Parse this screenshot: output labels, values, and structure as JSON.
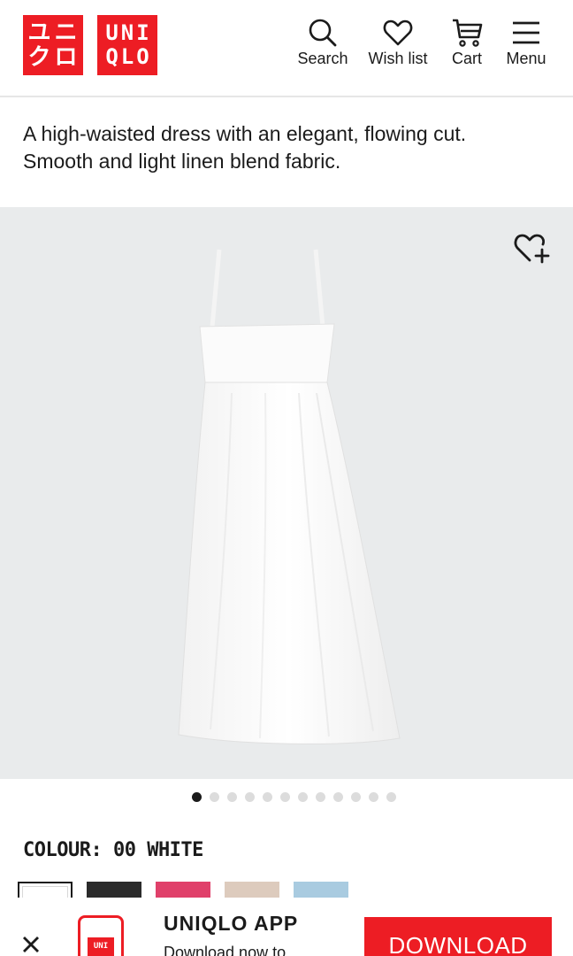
{
  "header": {
    "logo_kana_top": "ユニ",
    "logo_kana_bottom": "クロ",
    "logo_latin_top": "UNI",
    "logo_latin_bottom": "QLO",
    "nav": {
      "search_label": "Search",
      "wishlist_label": "Wish list",
      "cart_label": "Cart",
      "menu_label": "Menu"
    }
  },
  "product": {
    "description_line1": "A high-waisted dress with an elegant, flowing cut.",
    "description_line2": "Smooth and light linen blend fabric.",
    "image_count": 12,
    "active_image": 1,
    "colour_label": "COLOUR: 00 WHITE",
    "swatches": [
      {
        "name": "white",
        "color": "#ffffff"
      },
      {
        "name": "black",
        "color": "#2b2b2b"
      },
      {
        "name": "pink",
        "color": "#e0406a"
      },
      {
        "name": "beige",
        "color": "#ddcbbd"
      },
      {
        "name": "light-blue",
        "color": "#a9cbe0"
      }
    ]
  },
  "app_banner": {
    "title": "UNIQLO APP",
    "subtitle": "Download now to",
    "download_label": "DOWNLOAD",
    "icon_text": "UNI"
  },
  "colors": {
    "brand_red": "#ed1d24",
    "image_bg": "#e9ebec"
  }
}
